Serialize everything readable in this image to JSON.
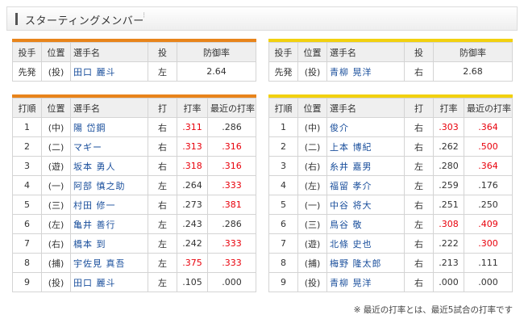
{
  "header": {
    "title": "スターティングメンバー",
    "dots": "⁝"
  },
  "columns": {
    "pitcher": [
      "投手",
      "位置",
      "選手名",
      "投",
      "防御率"
    ],
    "lineup": [
      "打順",
      "位置",
      "選手名",
      "打",
      "打率",
      "最近の打率"
    ]
  },
  "left": {
    "pitcher": {
      "role": "先発",
      "pos": "(投)",
      "name": "田口 麗斗",
      "hand": "左",
      "era": "2.64"
    },
    "lineup": [
      {
        "order": "1",
        "pos": "(中)",
        "name": "陽 岱鋼",
        "hand": "右",
        "avg": ".311",
        "avg_red": true,
        "recent": ".286",
        "recent_red": false
      },
      {
        "order": "2",
        "pos": "(二)",
        "name": "マギー",
        "hand": "右",
        "avg": ".313",
        "avg_red": true,
        "recent": ".316",
        "recent_red": true
      },
      {
        "order": "3",
        "pos": "(遊)",
        "name": "坂本 勇人",
        "hand": "右",
        "avg": ".318",
        "avg_red": true,
        "recent": ".316",
        "recent_red": true
      },
      {
        "order": "4",
        "pos": "(一)",
        "name": "阿部 慎之助",
        "hand": "左",
        "avg": ".264",
        "avg_red": false,
        "recent": ".333",
        "recent_red": true
      },
      {
        "order": "5",
        "pos": "(三)",
        "name": "村田 修一",
        "hand": "右",
        "avg": ".273",
        "avg_red": false,
        "recent": ".381",
        "recent_red": true
      },
      {
        "order": "6",
        "pos": "(左)",
        "name": "亀井 善行",
        "hand": "左",
        "avg": ".243",
        "avg_red": false,
        "recent": ".286",
        "recent_red": false
      },
      {
        "order": "7",
        "pos": "(右)",
        "name": "橋本 到",
        "hand": "左",
        "avg": ".242",
        "avg_red": false,
        "recent": ".333",
        "recent_red": true
      },
      {
        "order": "8",
        "pos": "(捕)",
        "name": "宇佐見 真吾",
        "hand": "左",
        "avg": ".375",
        "avg_red": true,
        "recent": ".333",
        "recent_red": true
      },
      {
        "order": "9",
        "pos": "(投)",
        "name": "田口 麗斗",
        "hand": "左",
        "avg": ".105",
        "avg_red": false,
        "recent": ".000",
        "recent_red": false
      }
    ]
  },
  "right": {
    "pitcher": {
      "role": "先発",
      "pos": "(投)",
      "name": "青柳 晃洋",
      "hand": "右",
      "era": "2.68"
    },
    "lineup": [
      {
        "order": "1",
        "pos": "(中)",
        "name": "俊介",
        "hand": "右",
        "avg": ".303",
        "avg_red": true,
        "recent": ".364",
        "recent_red": true
      },
      {
        "order": "2",
        "pos": "(二)",
        "name": "上本 博紀",
        "hand": "右",
        "avg": ".262",
        "avg_red": false,
        "recent": ".500",
        "recent_red": true
      },
      {
        "order": "3",
        "pos": "(右)",
        "name": "糸井 嘉男",
        "hand": "左",
        "avg": ".280",
        "avg_red": false,
        "recent": ".364",
        "recent_red": true
      },
      {
        "order": "4",
        "pos": "(左)",
        "name": "福留 孝介",
        "hand": "左",
        "avg": ".259",
        "avg_red": false,
        "recent": ".176",
        "recent_red": false
      },
      {
        "order": "5",
        "pos": "(一)",
        "name": "中谷 将大",
        "hand": "右",
        "avg": ".251",
        "avg_red": false,
        "recent": ".250",
        "recent_red": false
      },
      {
        "order": "6",
        "pos": "(三)",
        "name": "鳥谷 敬",
        "hand": "左",
        "avg": ".308",
        "avg_red": true,
        "recent": ".409",
        "recent_red": true
      },
      {
        "order": "7",
        "pos": "(遊)",
        "name": "北條 史也",
        "hand": "右",
        "avg": ".222",
        "avg_red": false,
        "recent": ".300",
        "recent_red": true
      },
      {
        "order": "8",
        "pos": "(捕)",
        "name": "梅野 隆太郎",
        "hand": "右",
        "avg": ".213",
        "avg_red": false,
        "recent": ".111",
        "recent_red": false
      },
      {
        "order": "9",
        "pos": "(投)",
        "name": "青柳 晃洋",
        "hand": "右",
        "avg": ".000",
        "avg_red": false,
        "recent": ".000",
        "recent_red": false
      }
    ]
  },
  "footnote": "※ 最近の打率とは、最近5試合の打率です",
  "colors": {
    "team_left_accent": "#e8841b",
    "team_right_accent": "#f2d10f",
    "highlight": "#e8000b",
    "name": "#1a4f9c"
  }
}
